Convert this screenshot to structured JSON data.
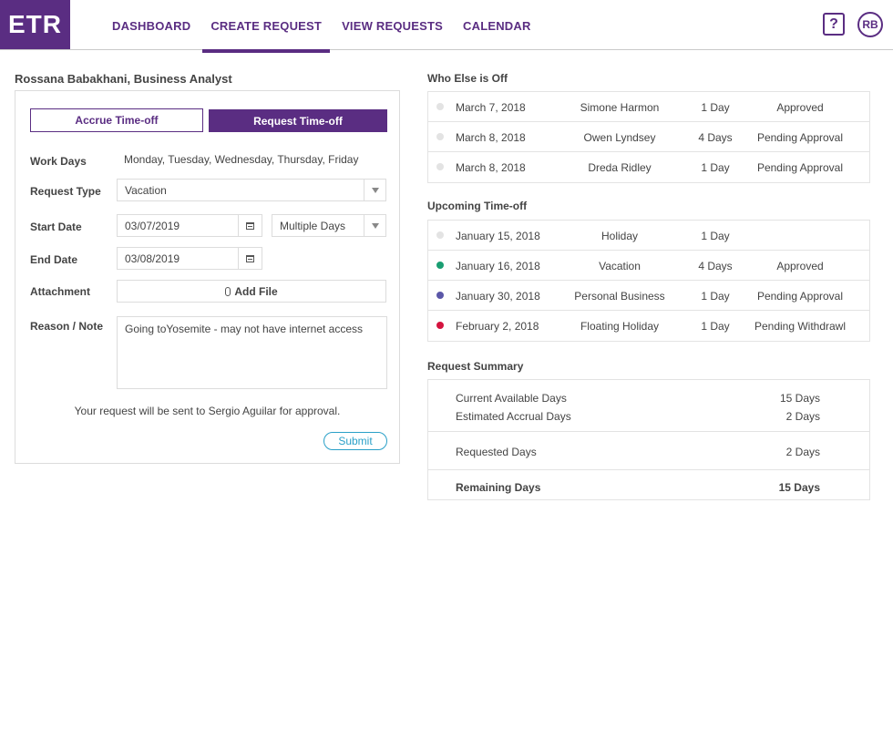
{
  "header": {
    "logo": "ETR",
    "nav": [
      "DASHBOARD",
      "CREATE REQUEST",
      "VIEW REQUESTS",
      "CALENDAR"
    ],
    "help": "?",
    "avatar": "RB"
  },
  "form": {
    "user_title": "Rossana Babakhani, Business Analyst",
    "accrue_label": "Accrue Time-off",
    "request_label": "Request Time-off",
    "work_days_label": "Work Days",
    "work_days_value": "Monday, Tuesday, Wednesday, Thursday, Friday",
    "request_type_label": "Request Type",
    "request_type_value": "Vacation",
    "start_date_label": "Start Date",
    "start_date_value": "03/07/2019",
    "duration_value": "Multiple Days",
    "end_date_label": "End Date",
    "end_date_value": "03/08/2019",
    "attachment_label": "Attachment",
    "add_file_label": "Add File",
    "reason_label": "Reason / Note",
    "reason_value": "Going toYosemite - may not have internet access",
    "send_note": "Your request will be sent to Sergio Aguilar for approval.",
    "submit_label": "Submit"
  },
  "who_else": {
    "title": "Who Else is Off",
    "rows": [
      {
        "date": "March 7, 2018",
        "name": "Simone Harmon",
        "days": "1 Day",
        "status": "Approved",
        "dot": "#e3e3e3"
      },
      {
        "date": "March 8, 2018",
        "name": "Owen Lyndsey",
        "days": "4 Days",
        "status": "Pending Approval",
        "dot": "#e3e3e3"
      },
      {
        "date": "March 8, 2018",
        "name": "Dreda Ridley",
        "days": "1 Day",
        "status": "Pending Approval",
        "dot": "#e3e3e3"
      }
    ]
  },
  "upcoming": {
    "title": "Upcoming Time-off",
    "rows": [
      {
        "date": "January 15, 2018",
        "type": "Holiday",
        "days": "1 Day",
        "status": "",
        "dot": "#e3e3e3"
      },
      {
        "date": "January 16, 2018",
        "type": "Vacation",
        "days": "4 Days",
        "status": "Approved",
        "dot": "#1a9e72"
      },
      {
        "date": "January 30, 2018",
        "type": "Personal Business",
        "days": "1 Day",
        "status": "Pending Approval",
        "dot": "#5b57a8"
      },
      {
        "date": "February 2, 2018",
        "type": "Floating Holiday",
        "days": "1 Day",
        "status": "Pending Withdrawl",
        "dot": "#d4143f"
      }
    ]
  },
  "summary": {
    "title": "Request Summary",
    "current_label": "Current Available Days",
    "current_value": "15 Days",
    "accrual_label": "Estimated Accrual Days",
    "accrual_value": "2 Days",
    "requested_label": "Requested Days",
    "requested_value": "2 Days",
    "remaining_label": "Remaining Days",
    "remaining_value": "15 Days"
  },
  "colors": {
    "brand": "#5a2d82",
    "submit": "#2aa0c8"
  }
}
